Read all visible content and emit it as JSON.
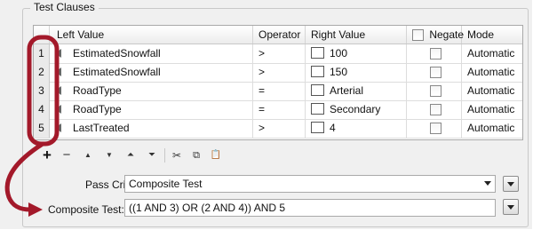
{
  "group_title": "Test Clauses",
  "columns": {
    "left_value": "Left Value",
    "operator": "Operator",
    "right_value": "Right Value",
    "negate": "Negate",
    "mode": "Mode"
  },
  "rows": [
    {
      "num": "1",
      "left": "EstimatedSnowfall",
      "op": ">",
      "right": "100",
      "negate": false,
      "mode": "Automatic"
    },
    {
      "num": "2",
      "left": "EstimatedSnowfall",
      "op": ">",
      "right": "150",
      "negate": false,
      "mode": "Automatic"
    },
    {
      "num": "3",
      "left": "RoadType",
      "op": "=",
      "right": "Arterial",
      "negate": false,
      "mode": "Automatic"
    },
    {
      "num": "4",
      "left": "RoadType",
      "op": "=",
      "right": "Secondary",
      "negate": false,
      "mode": "Automatic"
    },
    {
      "num": "5",
      "left": "LastTreated",
      "op": ">",
      "right": "4",
      "negate": false,
      "mode": "Automatic"
    }
  ],
  "toolbar": {
    "add": "+",
    "remove": "−",
    "move_up": "▲",
    "move_down": "▼",
    "move_top": "⏶",
    "move_bottom": "⏷",
    "cut": "✂",
    "copy": "⧉",
    "paste": "📋"
  },
  "pass_criteria": {
    "label": "Pass Criteria:",
    "value": "Composite Test"
  },
  "composite_test": {
    "label": "Composite Test:",
    "value": "((1 AND 3) OR (2 AND 4)) AND 5"
  },
  "annotation_color": "#a3192a"
}
